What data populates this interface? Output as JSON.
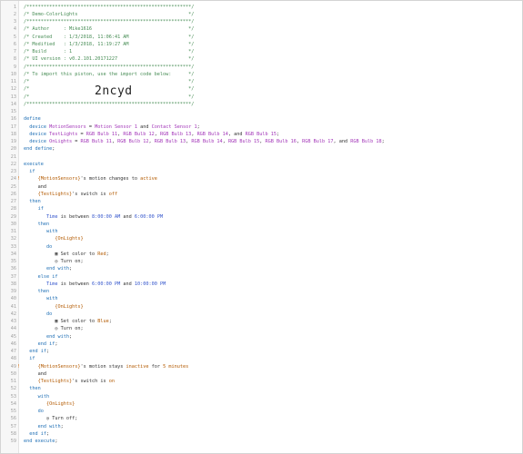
{
  "editor": {
    "import_code": "2ncyd",
    "lines": [
      {
        "n": "1",
        "parts": [
          [
            "c",
            "/**********************************************************/"
          ]
        ]
      },
      {
        "n": "2",
        "parts": [
          [
            "c",
            "/* Demo-ColorLights                                       */"
          ]
        ]
      },
      {
        "n": "3",
        "parts": [
          [
            "c",
            "/**********************************************************/"
          ]
        ]
      },
      {
        "n": "4",
        "parts": [
          [
            "c",
            "/* Author     : Mike1616                                  */"
          ]
        ]
      },
      {
        "n": "5",
        "parts": [
          [
            "c",
            "/* Created    : 1/3/2018, 11:06:41 AM                     */"
          ]
        ]
      },
      {
        "n": "6",
        "parts": [
          [
            "c",
            "/* Modified   : 1/3/2018, 11:19:27 AM                     */"
          ]
        ]
      },
      {
        "n": "7",
        "parts": [
          [
            "c",
            "/* Build      : 1                                         */"
          ]
        ]
      },
      {
        "n": "8",
        "parts": [
          [
            "c",
            "/* UI version : v0.2.101.20171227                         */"
          ]
        ]
      },
      {
        "n": "9",
        "parts": [
          [
            "c",
            "/**********************************************************/"
          ]
        ]
      },
      {
        "n": "10",
        "parts": [
          [
            "c",
            "/* To import this piston, use the import code below:      */"
          ]
        ]
      },
      {
        "n": "11",
        "parts": [
          [
            "c",
            "/*                                                        */"
          ]
        ]
      },
      {
        "n": "12",
        "parts": [
          [
            "c",
            "/*                                                        */"
          ]
        ]
      },
      {
        "n": "13",
        "parts": [
          [
            "c",
            "/*                                                        */"
          ]
        ]
      },
      {
        "n": "14",
        "parts": [
          [
            "c",
            "/**********************************************************/"
          ]
        ]
      },
      {
        "n": "15",
        "parts": []
      },
      {
        "n": "16",
        "parts": [
          [
            "k",
            "define"
          ]
        ]
      },
      {
        "n": "17",
        "parts": [
          [
            "p",
            "  "
          ],
          [
            "k",
            "device "
          ],
          [
            "d",
            "MotionSensors"
          ],
          [
            "p",
            " = "
          ],
          [
            "d",
            "Motion Sensor 1"
          ],
          [
            "p",
            " and "
          ],
          [
            "d",
            "Contact Sensor 1"
          ],
          [
            "p",
            ";"
          ]
        ]
      },
      {
        "n": "18",
        "parts": [
          [
            "p",
            "  "
          ],
          [
            "k",
            "device "
          ],
          [
            "d",
            "TestLights"
          ],
          [
            "p",
            " = "
          ],
          [
            "d",
            "RGB Bulb 11"
          ],
          [
            "p",
            ", "
          ],
          [
            "d",
            "RGB Bulb 12"
          ],
          [
            "p",
            ", "
          ],
          [
            "d",
            "RGB Bulb 13"
          ],
          [
            "p",
            ", "
          ],
          [
            "d",
            "RGB Bulb 14"
          ],
          [
            "p",
            ", and "
          ],
          [
            "d",
            "RGB Bulb 15"
          ],
          [
            "p",
            ";"
          ]
        ]
      },
      {
        "n": "19",
        "parts": [
          [
            "p",
            "  "
          ],
          [
            "k",
            "device "
          ],
          [
            "d",
            "OnLights"
          ],
          [
            "p",
            " = "
          ],
          [
            "d",
            "RGB Bulb 11"
          ],
          [
            "p",
            ", "
          ],
          [
            "d",
            "RGB Bulb 12"
          ],
          [
            "p",
            ", "
          ],
          [
            "d",
            "RGB Bulb 13"
          ],
          [
            "p",
            ", "
          ],
          [
            "d",
            "RGB Bulb 14"
          ],
          [
            "p",
            ", "
          ],
          [
            "d",
            "RGB Bulb 15"
          ],
          [
            "p",
            ", "
          ],
          [
            "d",
            "RGB Bulb 16"
          ],
          [
            "p",
            ", "
          ],
          [
            "d",
            "RGB Bulb 17"
          ],
          [
            "p",
            ", and "
          ],
          [
            "d",
            "RGB Bulb 18"
          ],
          [
            "p",
            ";"
          ]
        ]
      },
      {
        "n": "20",
        "parts": [
          [
            "k",
            "end define"
          ],
          [
            "p",
            ";"
          ]
        ]
      },
      {
        "n": "21",
        "parts": []
      },
      {
        "n": "22",
        "parts": [
          [
            "k",
            "execute"
          ]
        ]
      },
      {
        "n": "23",
        "parts": [
          [
            "p",
            "  "
          ],
          [
            "k",
            "if"
          ]
        ]
      },
      {
        "n": "24",
        "err": "!",
        "parts": [
          [
            "p",
            "     "
          ],
          [
            "o",
            "{MotionSensors}"
          ],
          [
            "p",
            "'s motion changes to "
          ],
          [
            "o",
            "active"
          ]
        ]
      },
      {
        "n": "25",
        "parts": [
          [
            "p",
            "     and"
          ]
        ]
      },
      {
        "n": "26",
        "parts": [
          [
            "p",
            "     "
          ],
          [
            "o",
            "{TestLights}"
          ],
          [
            "p",
            "'s switch is "
          ],
          [
            "o",
            "off"
          ]
        ]
      },
      {
        "n": "27",
        "parts": [
          [
            "p",
            "  "
          ],
          [
            "k",
            "then"
          ]
        ]
      },
      {
        "n": "28",
        "parts": [
          [
            "p",
            "     "
          ],
          [
            "k",
            "if"
          ]
        ]
      },
      {
        "n": "29",
        "parts": [
          [
            "p",
            "        "
          ],
          [
            "t",
            "Time"
          ],
          [
            "p",
            " is between "
          ],
          [
            "t",
            "8:00:00 AM"
          ],
          [
            "p",
            " and "
          ],
          [
            "t",
            "6:00:00 PM"
          ]
        ]
      },
      {
        "n": "30",
        "parts": [
          [
            "p",
            "     "
          ],
          [
            "k",
            "then"
          ]
        ]
      },
      {
        "n": "31",
        "parts": [
          [
            "p",
            "        "
          ],
          [
            "k",
            "with"
          ]
        ]
      },
      {
        "n": "32",
        "parts": [
          [
            "p",
            "           "
          ],
          [
            "o",
            "{OnLights}"
          ]
        ]
      },
      {
        "n": "33",
        "parts": [
          [
            "p",
            "        "
          ],
          [
            "k",
            "do"
          ]
        ]
      },
      {
        "n": "34",
        "parts": [
          [
            "p",
            "           ▦ Set color to "
          ],
          [
            "o",
            "Red"
          ],
          [
            "p",
            ";"
          ]
        ]
      },
      {
        "n": "35",
        "parts": [
          [
            "p",
            "           ◎ Turn on;"
          ]
        ]
      },
      {
        "n": "36",
        "parts": [
          [
            "p",
            "        "
          ],
          [
            "k",
            "end with"
          ],
          [
            "p",
            ";"
          ]
        ]
      },
      {
        "n": "37",
        "parts": [
          [
            "p",
            "     "
          ],
          [
            "k",
            "else if"
          ]
        ]
      },
      {
        "n": "38",
        "parts": [
          [
            "p",
            "        "
          ],
          [
            "t",
            "Time"
          ],
          [
            "p",
            " is between "
          ],
          [
            "t",
            "6:00:00 PM"
          ],
          [
            "p",
            " and "
          ],
          [
            "t",
            "10:00:00 PM"
          ]
        ]
      },
      {
        "n": "39",
        "parts": [
          [
            "p",
            "     "
          ],
          [
            "k",
            "then"
          ]
        ]
      },
      {
        "n": "40",
        "parts": [
          [
            "p",
            "        "
          ],
          [
            "k",
            "with"
          ]
        ]
      },
      {
        "n": "41",
        "parts": [
          [
            "p",
            "           "
          ],
          [
            "o",
            "{OnLights}"
          ]
        ]
      },
      {
        "n": "42",
        "parts": [
          [
            "p",
            "        "
          ],
          [
            "k",
            "do"
          ]
        ]
      },
      {
        "n": "43",
        "parts": [
          [
            "p",
            "           ▦ Set color to "
          ],
          [
            "o",
            "Blue"
          ],
          [
            "p",
            ";"
          ]
        ]
      },
      {
        "n": "44",
        "parts": [
          [
            "p",
            "           ◎ Turn on;"
          ]
        ]
      },
      {
        "n": "45",
        "parts": [
          [
            "p",
            "        "
          ],
          [
            "k",
            "end with"
          ],
          [
            "p",
            ";"
          ]
        ]
      },
      {
        "n": "46",
        "parts": [
          [
            "p",
            "     "
          ],
          [
            "k",
            "end if"
          ],
          [
            "p",
            ";"
          ]
        ]
      },
      {
        "n": "47",
        "parts": [
          [
            "p",
            "  "
          ],
          [
            "k",
            "end if"
          ],
          [
            "p",
            ";"
          ]
        ]
      },
      {
        "n": "48",
        "parts": [
          [
            "p",
            "  "
          ],
          [
            "k",
            "if"
          ]
        ]
      },
      {
        "n": "49",
        "err": "!",
        "parts": [
          [
            "p",
            "     "
          ],
          [
            "o",
            "{MotionSensors}"
          ],
          [
            "p",
            "'s motion stays "
          ],
          [
            "o",
            "inactive"
          ],
          [
            "p",
            " for "
          ],
          [
            "o",
            "5 minutes"
          ]
        ]
      },
      {
        "n": "50",
        "parts": [
          [
            "p",
            "     and"
          ]
        ]
      },
      {
        "n": "51",
        "parts": [
          [
            "p",
            "     "
          ],
          [
            "o",
            "{TestLights}"
          ],
          [
            "p",
            "'s switch is "
          ],
          [
            "o",
            "on"
          ]
        ]
      },
      {
        "n": "52",
        "parts": [
          [
            "p",
            "  "
          ],
          [
            "k",
            "then"
          ]
        ]
      },
      {
        "n": "53",
        "parts": [
          [
            "p",
            "     "
          ],
          [
            "k",
            "with"
          ]
        ]
      },
      {
        "n": "54",
        "parts": [
          [
            "p",
            "        "
          ],
          [
            "o",
            "{OnLights}"
          ]
        ]
      },
      {
        "n": "55",
        "parts": [
          [
            "p",
            "     "
          ],
          [
            "k",
            "do"
          ]
        ]
      },
      {
        "n": "56",
        "parts": [
          [
            "p",
            "        ◎ Turn off;"
          ]
        ]
      },
      {
        "n": "57",
        "parts": [
          [
            "p",
            "     "
          ],
          [
            "k",
            "end with"
          ],
          [
            "p",
            ";"
          ]
        ]
      },
      {
        "n": "58",
        "parts": [
          [
            "p",
            "  "
          ],
          [
            "k",
            "end if"
          ],
          [
            "p",
            ";"
          ]
        ]
      },
      {
        "n": "59",
        "parts": [
          [
            "k",
            "end execute"
          ],
          [
            "p",
            ";"
          ]
        ]
      }
    ]
  }
}
